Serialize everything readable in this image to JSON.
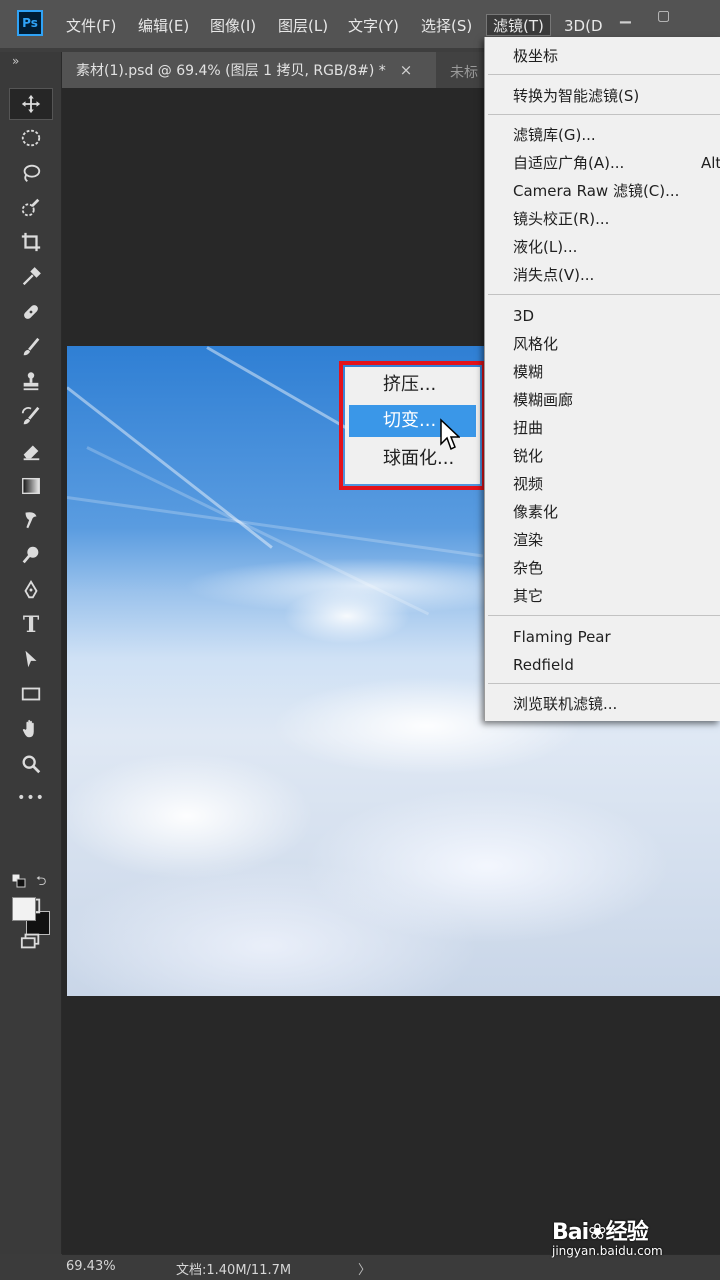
{
  "app": {
    "logo": "Ps"
  },
  "menubar": {
    "items": [
      "文件(F)",
      "编辑(E)",
      "图像(I)",
      "图层(L)",
      "文字(Y)",
      "选择(S)",
      "滤镜(T)",
      "3D(D"
    ],
    "active_index": 6,
    "window_controls": [
      "minimize-icon",
      "maximize-icon"
    ]
  },
  "tabs": {
    "active": "素材(1).psd @ 69.4% (图层 1 拷贝, RGB/8#) *",
    "close_symbol": "×",
    "inactive": "未标"
  },
  "toolbar": {
    "tools": [
      "move-tool",
      "marquee-tool",
      "lasso-tool",
      "quick-select-tool",
      "crop-tool",
      "eyedropper-tool",
      "healing-brush-tool",
      "brush-tool",
      "clone-stamp-tool",
      "history-brush-tool",
      "eraser-tool",
      "gradient-tool",
      "smudge-tool",
      "dodge-tool",
      "pen-tool",
      "type-tool",
      "path-select-tool",
      "rectangle-tool",
      "hand-tool",
      "zoom-tool",
      "more-tools"
    ],
    "selected": "move-tool",
    "type_tool_glyph": "T",
    "more_glyph": "•••",
    "foreground_color": "#f2f2f2",
    "background_color": "#111111"
  },
  "filter_menu": {
    "items": [
      {
        "label": "极坐标"
      },
      {
        "label": "转换为智能滤镜(S)"
      },
      {
        "label": "滤镜库(G)..."
      },
      {
        "label": "自适应广角(A)...",
        "shortcut": "Alt"
      },
      {
        "label": "Camera Raw 滤镜(C)..."
      },
      {
        "label": "镜头校正(R)..."
      },
      {
        "label": "液化(L)..."
      },
      {
        "label": "消失点(V)..."
      },
      {
        "label": "3D"
      },
      {
        "label": "风格化"
      },
      {
        "label": "模糊"
      },
      {
        "label": "模糊画廊"
      },
      {
        "label": "扭曲"
      },
      {
        "label": "锐化"
      },
      {
        "label": "视频"
      },
      {
        "label": "像素化"
      },
      {
        "label": "渲染"
      },
      {
        "label": "杂色"
      },
      {
        "label": "其它"
      },
      {
        "label": "Flaming Pear"
      },
      {
        "label": "Redfield"
      },
      {
        "label": "浏览联机滤镜..."
      }
    ]
  },
  "submenu": {
    "items": [
      "挤压...",
      "切变...",
      "球面化..."
    ],
    "hover_index": 1,
    "highlight_color": "#e3121b"
  },
  "status": {
    "zoom": "69.43%",
    "doc": "文档:1.40M/11.7M",
    "arrow": "〉"
  },
  "watermark": {
    "brand_left": "Bai",
    "brand_right": "经验",
    "url": "jingyan.baidu.com"
  }
}
